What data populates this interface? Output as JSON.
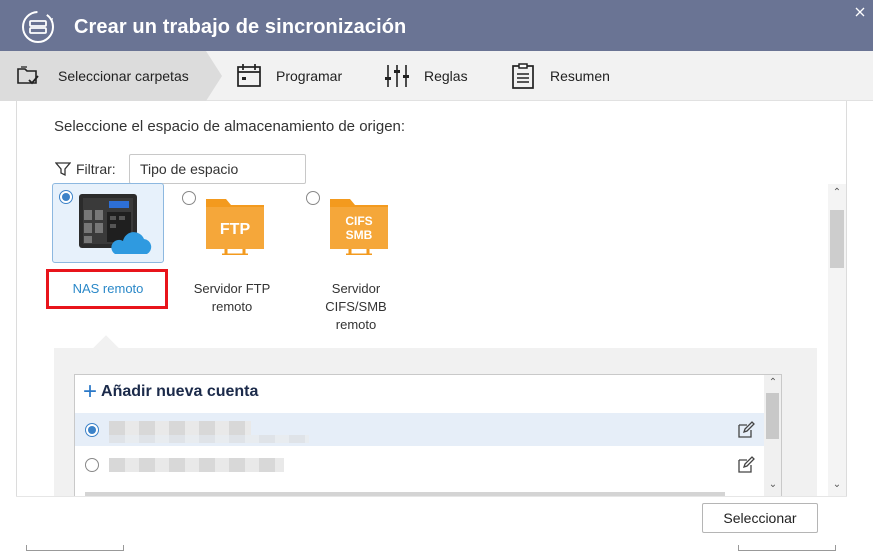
{
  "window": {
    "title": "Crear un trabajo de sincronización",
    "app_icon": "sync-app-icon",
    "close_icon": "close-icon"
  },
  "steps": [
    {
      "label": "Seleccionar carpetas",
      "icon": "folder-check-icon",
      "active": true
    },
    {
      "label": "Programar",
      "icon": "calendar-icon",
      "active": false
    },
    {
      "label": "Reglas",
      "icon": "sliders-icon",
      "active": false
    },
    {
      "label": "Resumen",
      "icon": "clipboard-icon",
      "active": false
    }
  ],
  "main": {
    "prompt": "Seleccione el espacio de almacenamiento de origen:",
    "filter_label": "Filtrar:",
    "filter_value": "Tipo de espacio",
    "options": [
      {
        "label": "NAS remoto",
        "icon": "nas-cloud-icon",
        "selected": true
      },
      {
        "label_line1": "Servidor FTP",
        "label_line2": "remoto",
        "icon_text": "FTP",
        "icon": "ftp-folder-icon",
        "selected": false
      },
      {
        "label_line1": "Servidor",
        "label_line2": "CIFS/SMB",
        "label_line3": "remoto",
        "icon_text_line1": "CIFS",
        "icon_text_line2": "SMB",
        "icon": "cifs-smb-folder-icon",
        "selected": false
      }
    ],
    "accounts": {
      "add_label": "Añadir nueva cuenta",
      "rows": [
        {
          "selected": true
        },
        {
          "selected": false
        }
      ]
    }
  },
  "footer": {
    "select_label": "Seleccionar"
  },
  "colors": {
    "titlebar": "#6a7494",
    "accent": "#3c82c8",
    "highlight": "#e8141b",
    "folder_orange": "#f39a1e"
  }
}
